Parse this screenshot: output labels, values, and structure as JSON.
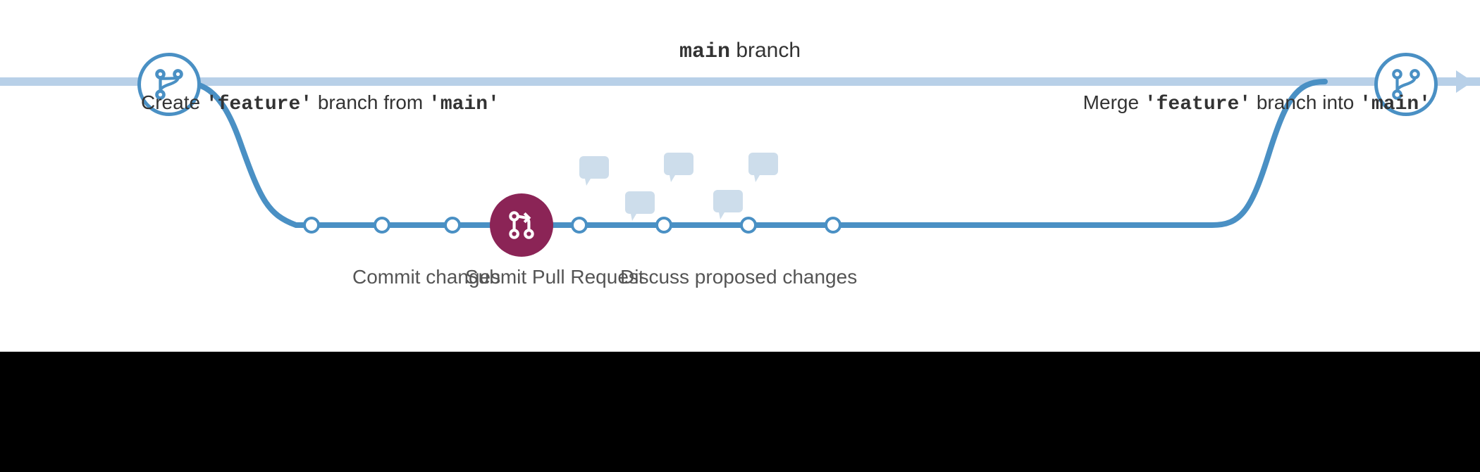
{
  "diagram": {
    "main_branch_label": "'main' branch",
    "main_branch_keyword": "main",
    "create_label_prefix": "Create ",
    "create_feature_keyword": "'feature'",
    "create_label_middle": " branch from ",
    "create_main_keyword": "'main'",
    "merge_label_prefix": "Merge ",
    "merge_feature_keyword": "'feature'",
    "merge_label_middle": " branch into ",
    "merge_main_keyword": "'main'",
    "commit_label": "Commit changes",
    "pr_label": "Submit Pull Request",
    "discuss_label": "Discuss proposed changes",
    "branch_color": "#4a90c4",
    "pr_color": "#8b2456",
    "node_bg": "#ffffff",
    "chat_color": "#c5d8e8"
  }
}
